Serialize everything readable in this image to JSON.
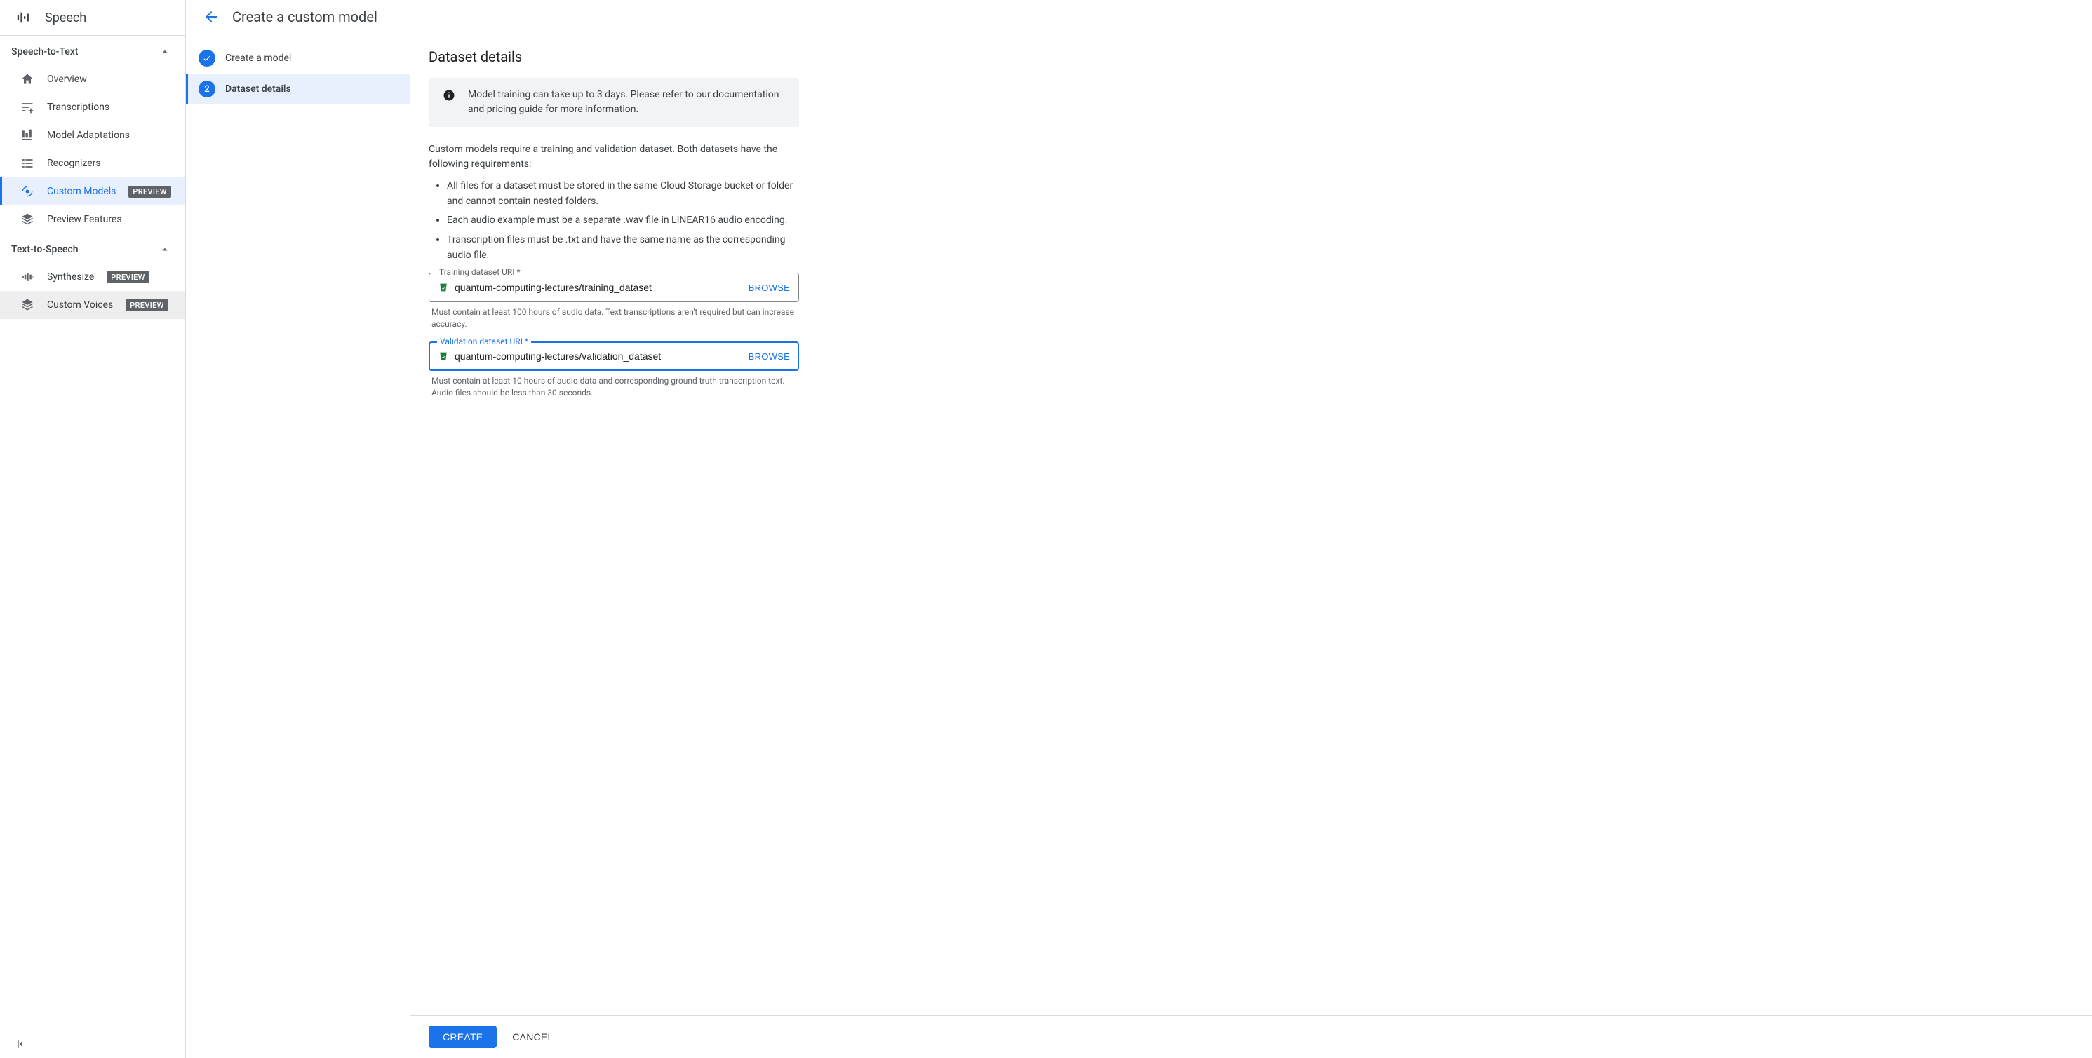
{
  "product": {
    "name": "Speech"
  },
  "sidebar": {
    "sections": [
      {
        "title": "Speech-to-Text",
        "items": [
          {
            "label": "Overview",
            "icon": "home-icon",
            "active": false,
            "badge": null
          },
          {
            "label": "Transcriptions",
            "icon": "tune-icon",
            "active": false,
            "badge": null
          },
          {
            "label": "Model Adaptations",
            "icon": "adapt-icon",
            "active": false,
            "badge": null
          },
          {
            "label": "Recognizers",
            "icon": "list-icon",
            "active": false,
            "badge": null
          },
          {
            "label": "Custom Models",
            "icon": "model-icon",
            "active": true,
            "badge": "PREVIEW"
          },
          {
            "label": "Preview Features",
            "icon": "layers-icon",
            "active": false,
            "badge": null
          }
        ]
      },
      {
        "title": "Text-to-Speech",
        "items": [
          {
            "label": "Synthesize",
            "icon": "wave-icon",
            "active": false,
            "badge": "PREVIEW"
          },
          {
            "label": "Custom Voices",
            "icon": "layers-icon",
            "active": false,
            "hovered": true,
            "badge": "PREVIEW"
          }
        ]
      }
    ]
  },
  "header": {
    "title": "Create a custom model"
  },
  "stepper": {
    "steps": [
      {
        "label": "Create a model",
        "completed": true
      },
      {
        "label": "Dataset details",
        "number": "2",
        "active": true
      }
    ]
  },
  "details": {
    "title": "Dataset details",
    "banner": "Model training can take up to 3 days. Please refer to our documentation and pricing guide for more information.",
    "intro": "Custom models require a training and validation dataset. Both datasets have the following requirements:",
    "requirements": [
      "All files for a dataset must be stored in the same Cloud Storage bucket or folder and cannot contain nested folders.",
      "Each audio example must be a separate .wav file in LINEAR16 audio encoding.",
      "Transcription files must be .txt and have the same name as the corresponding audio file."
    ],
    "training": {
      "label": "Training dataset URI *",
      "value": "quantum-computing-lectures/training_dataset",
      "browse": "BROWSE",
      "helper": "Must contain at least 100 hours of audio data. Text transcriptions aren't required but can increase accuracy."
    },
    "validation": {
      "label": "Validation dataset URI *",
      "value": "quantum-computing-lectures/validation_dataset",
      "browse": "BROWSE",
      "helper": "Must contain at least 10 hours of audio data and corresponding ground truth transcription text. Audio files should be less than 30 seconds."
    }
  },
  "footer": {
    "create": "CREATE",
    "cancel": "CANCEL"
  }
}
